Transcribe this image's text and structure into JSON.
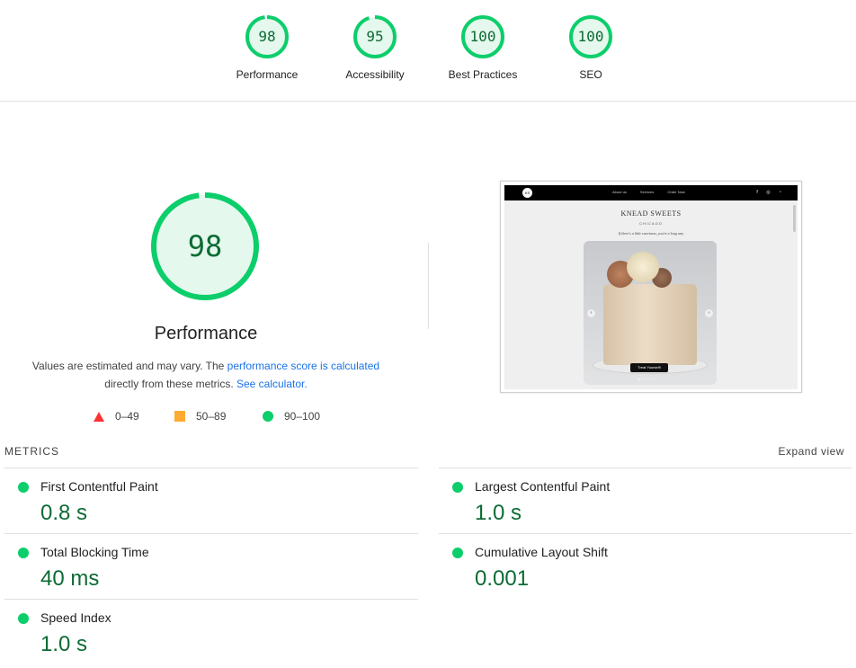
{
  "summary": {
    "gauges": [
      {
        "score": "98",
        "label": "Performance",
        "value": 0.98
      },
      {
        "score": "95",
        "label": "Accessibility",
        "value": 0.95
      },
      {
        "score": "100",
        "label": "Best Practices",
        "value": 1.0
      },
      {
        "score": "100",
        "label": "SEO",
        "value": 1.0
      }
    ]
  },
  "performance": {
    "score": "98",
    "value": 0.98,
    "title": "Performance",
    "desc_prefix": "Values are estimated and may vary. The ",
    "desc_link": "performance score is calculated",
    "desc_mid": "directly from these metrics. ",
    "desc_calc_link": "See calculator.",
    "legend": {
      "fail": "0–49",
      "average": "50–89",
      "pass": "90–100"
    }
  },
  "thumbnail": {
    "logo": "KS",
    "nav_links": [
      "About us",
      "Services",
      "Order Now"
    ],
    "social": [
      "f",
      "◎",
      "◔"
    ],
    "title": "KNEAD SWEETS",
    "subtitle": "CHICAGO",
    "tagline": "If there's a little sweetness, you're a long way",
    "hero_button": "Treat Yourself!",
    "hero_dots": "●○○○○○"
  },
  "metrics": {
    "heading": "METRICS",
    "expand": "Expand view",
    "items": [
      {
        "label": "First Contentful Paint",
        "value": "0.8 s"
      },
      {
        "label": "Largest Contentful Paint",
        "value": "1.0 s"
      },
      {
        "label": "Total Blocking Time",
        "value": "40 ms"
      },
      {
        "label": "Cumulative Layout Shift",
        "value": "0.001"
      },
      {
        "label": "Speed Index",
        "value": "1.0 s"
      }
    ]
  },
  "colors": {
    "pass": "#0cce6b",
    "pass_text": "#0c6b34",
    "pass_bg": "#e5f8ed",
    "average": "#ffaa33",
    "fail": "#ff3333",
    "link": "#1a73e8"
  }
}
